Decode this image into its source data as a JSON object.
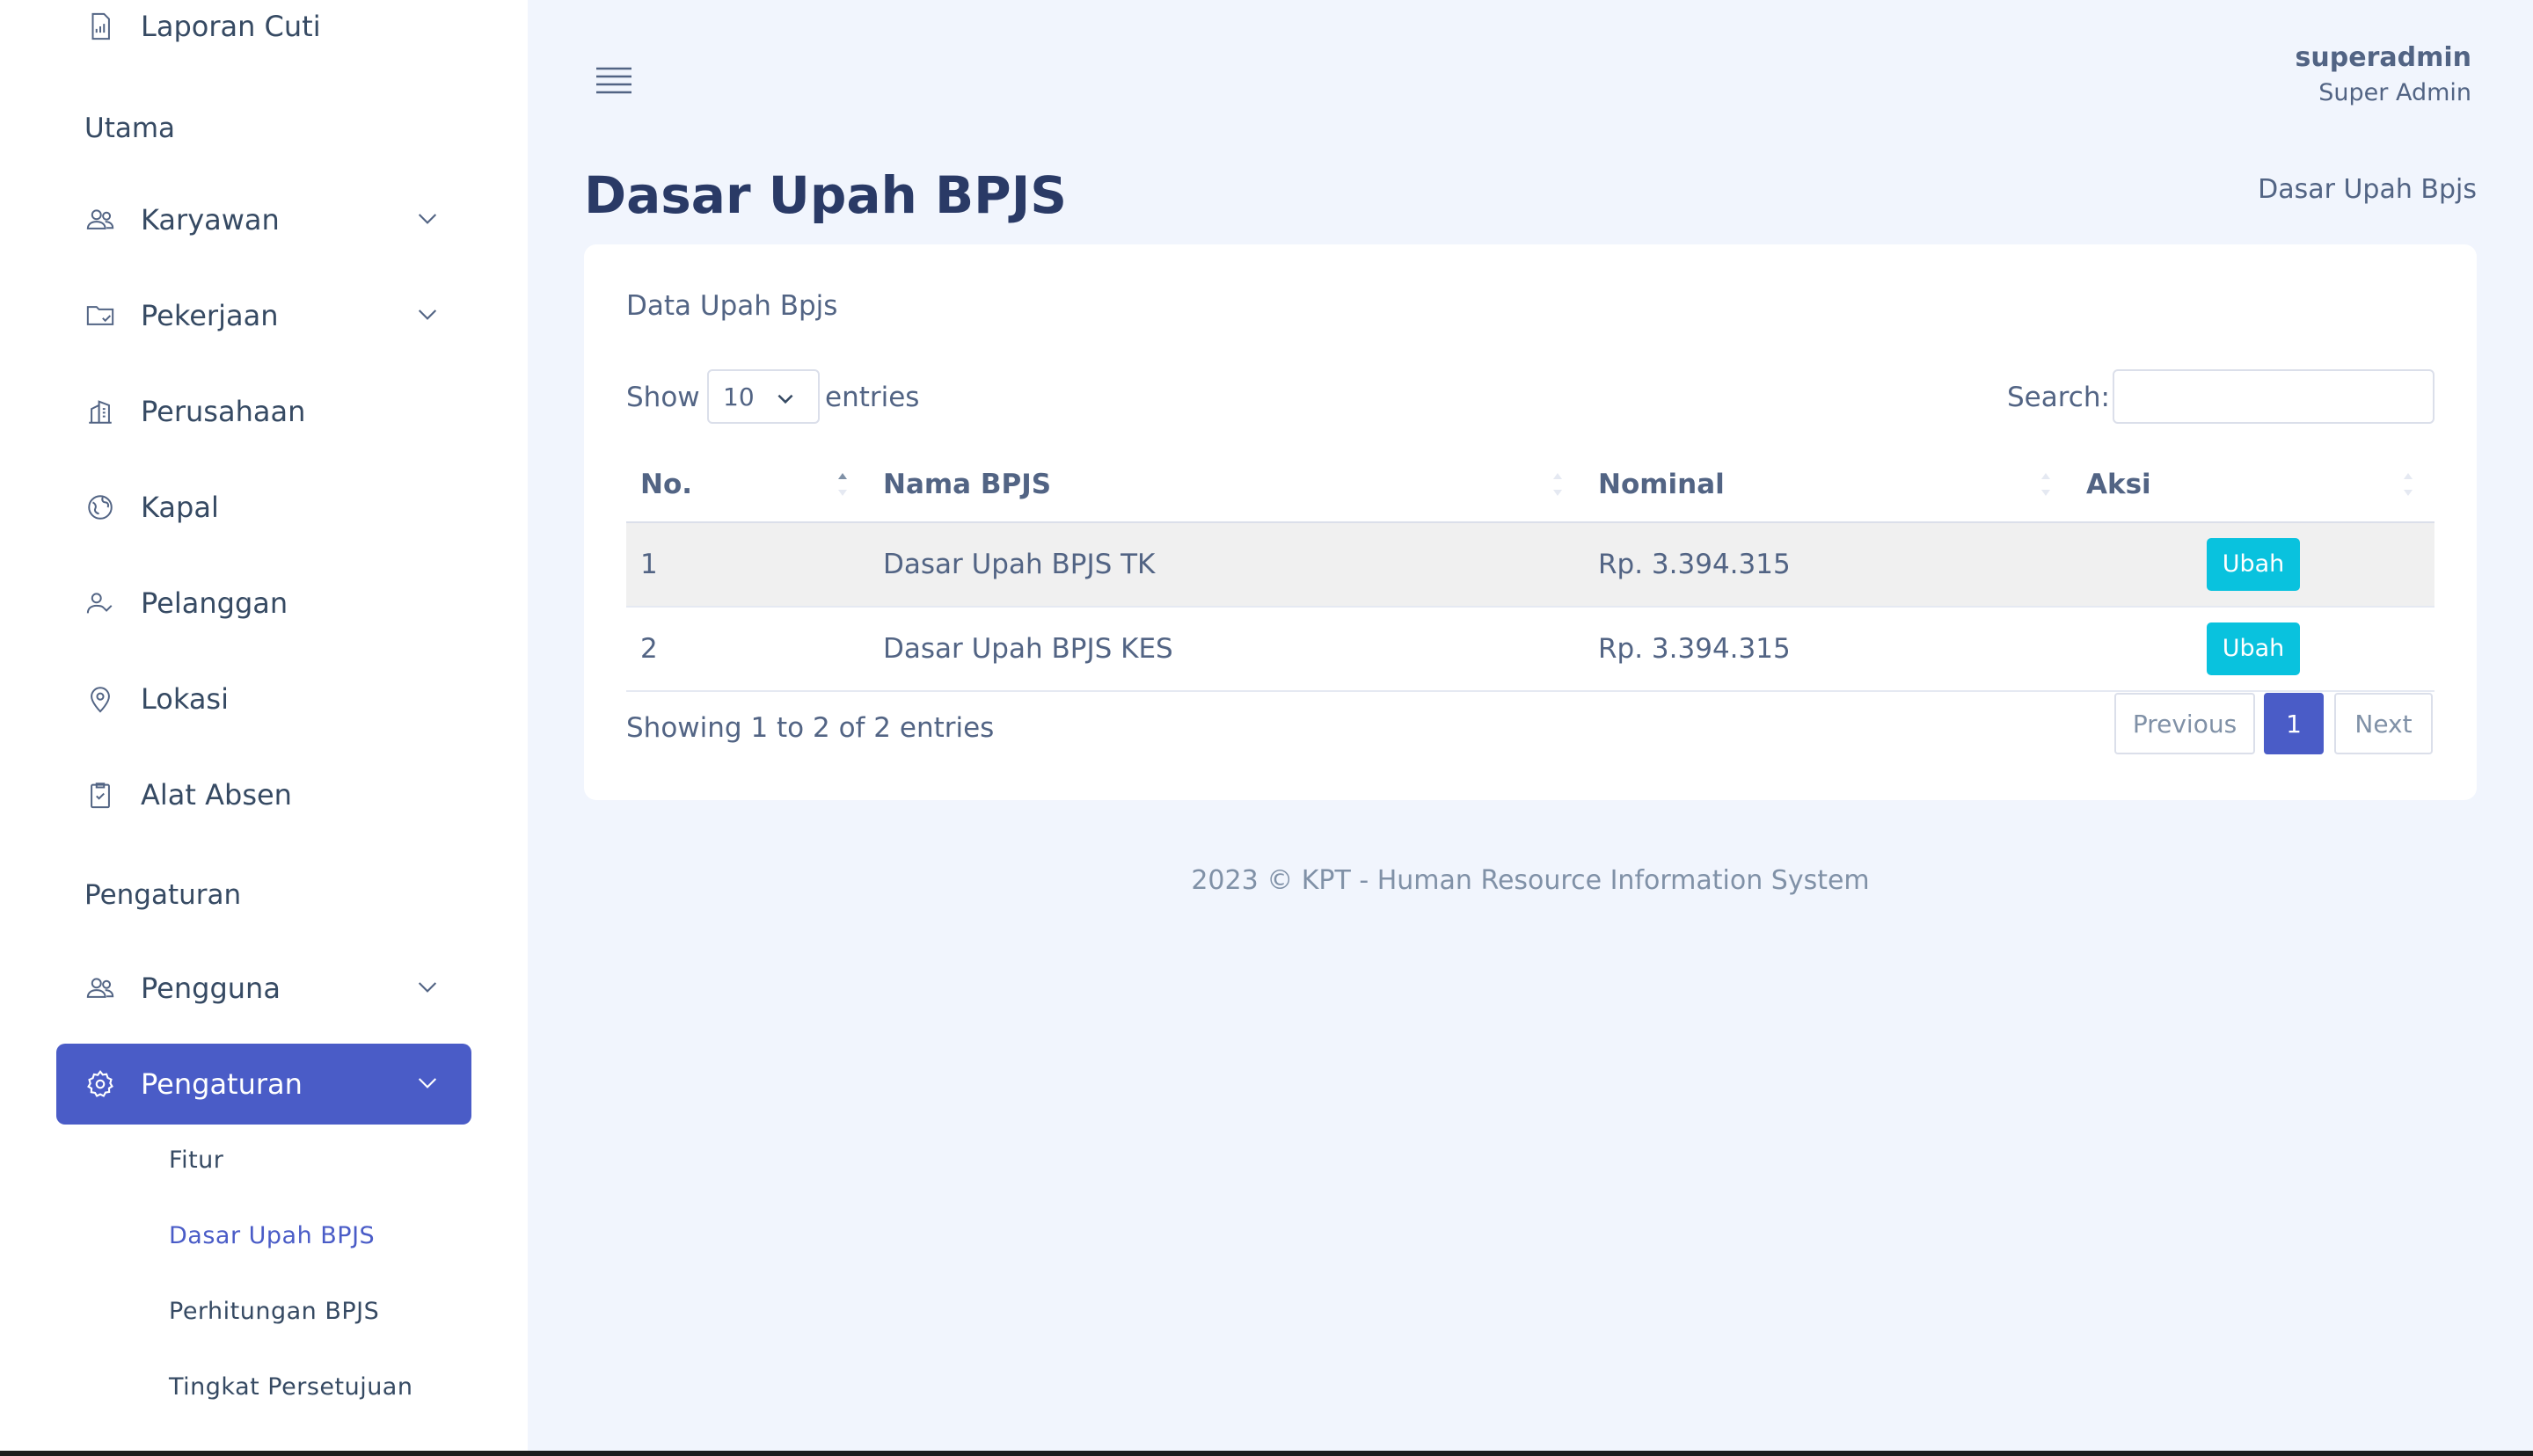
{
  "sidebar": {
    "top_item": "Laporan Cuti",
    "section_main": "Utama",
    "items": [
      {
        "label": "Karyawan"
      },
      {
        "label": "Pekerjaan"
      },
      {
        "label": "Perusahaan"
      },
      {
        "label": "Kapal"
      },
      {
        "label": "Pelanggan"
      },
      {
        "label": "Lokasi"
      },
      {
        "label": "Alat Absen"
      }
    ],
    "section_settings": "Pengaturan",
    "settings_items": [
      {
        "label": "Pengguna"
      },
      {
        "label": "Pengaturan"
      }
    ],
    "sub_items": [
      "Fitur",
      "Dasar Upah BPJS",
      "Perhitungan BPJS",
      "Tingkat Persetujuan"
    ]
  },
  "header": {
    "username": "superadmin",
    "role": "Super Admin"
  },
  "page": {
    "title": "Dasar Upah BPJS",
    "breadcrumb": "Dasar Upah Bpjs"
  },
  "card": {
    "title": "Data Upah Bpjs",
    "show_label": "Show",
    "length_value": "10",
    "entries_label": "entries",
    "search_label": "Search:",
    "search_value": "",
    "columns": [
      "No.",
      "Nama BPJS",
      "Nominal",
      "Aksi"
    ],
    "rows": [
      {
        "no": "1",
        "nama": "Dasar Upah BPJS TK",
        "nominal": "Rp. 3.394.315",
        "action": "Ubah"
      },
      {
        "no": "2",
        "nama": "Dasar Upah BPJS KES",
        "nominal": "Rp. 3.394.315",
        "action": "Ubah"
      }
    ],
    "info": "Showing 1 to 2 of 2 entries",
    "pagination": {
      "previous": "Previous",
      "current": "1",
      "next": "Next"
    }
  },
  "footer": "2023 © KPT - Human Resource Information System",
  "colors": {
    "accent": "#4a5cc7",
    "button": "#09c2de",
    "background": "#f1f5fd"
  }
}
